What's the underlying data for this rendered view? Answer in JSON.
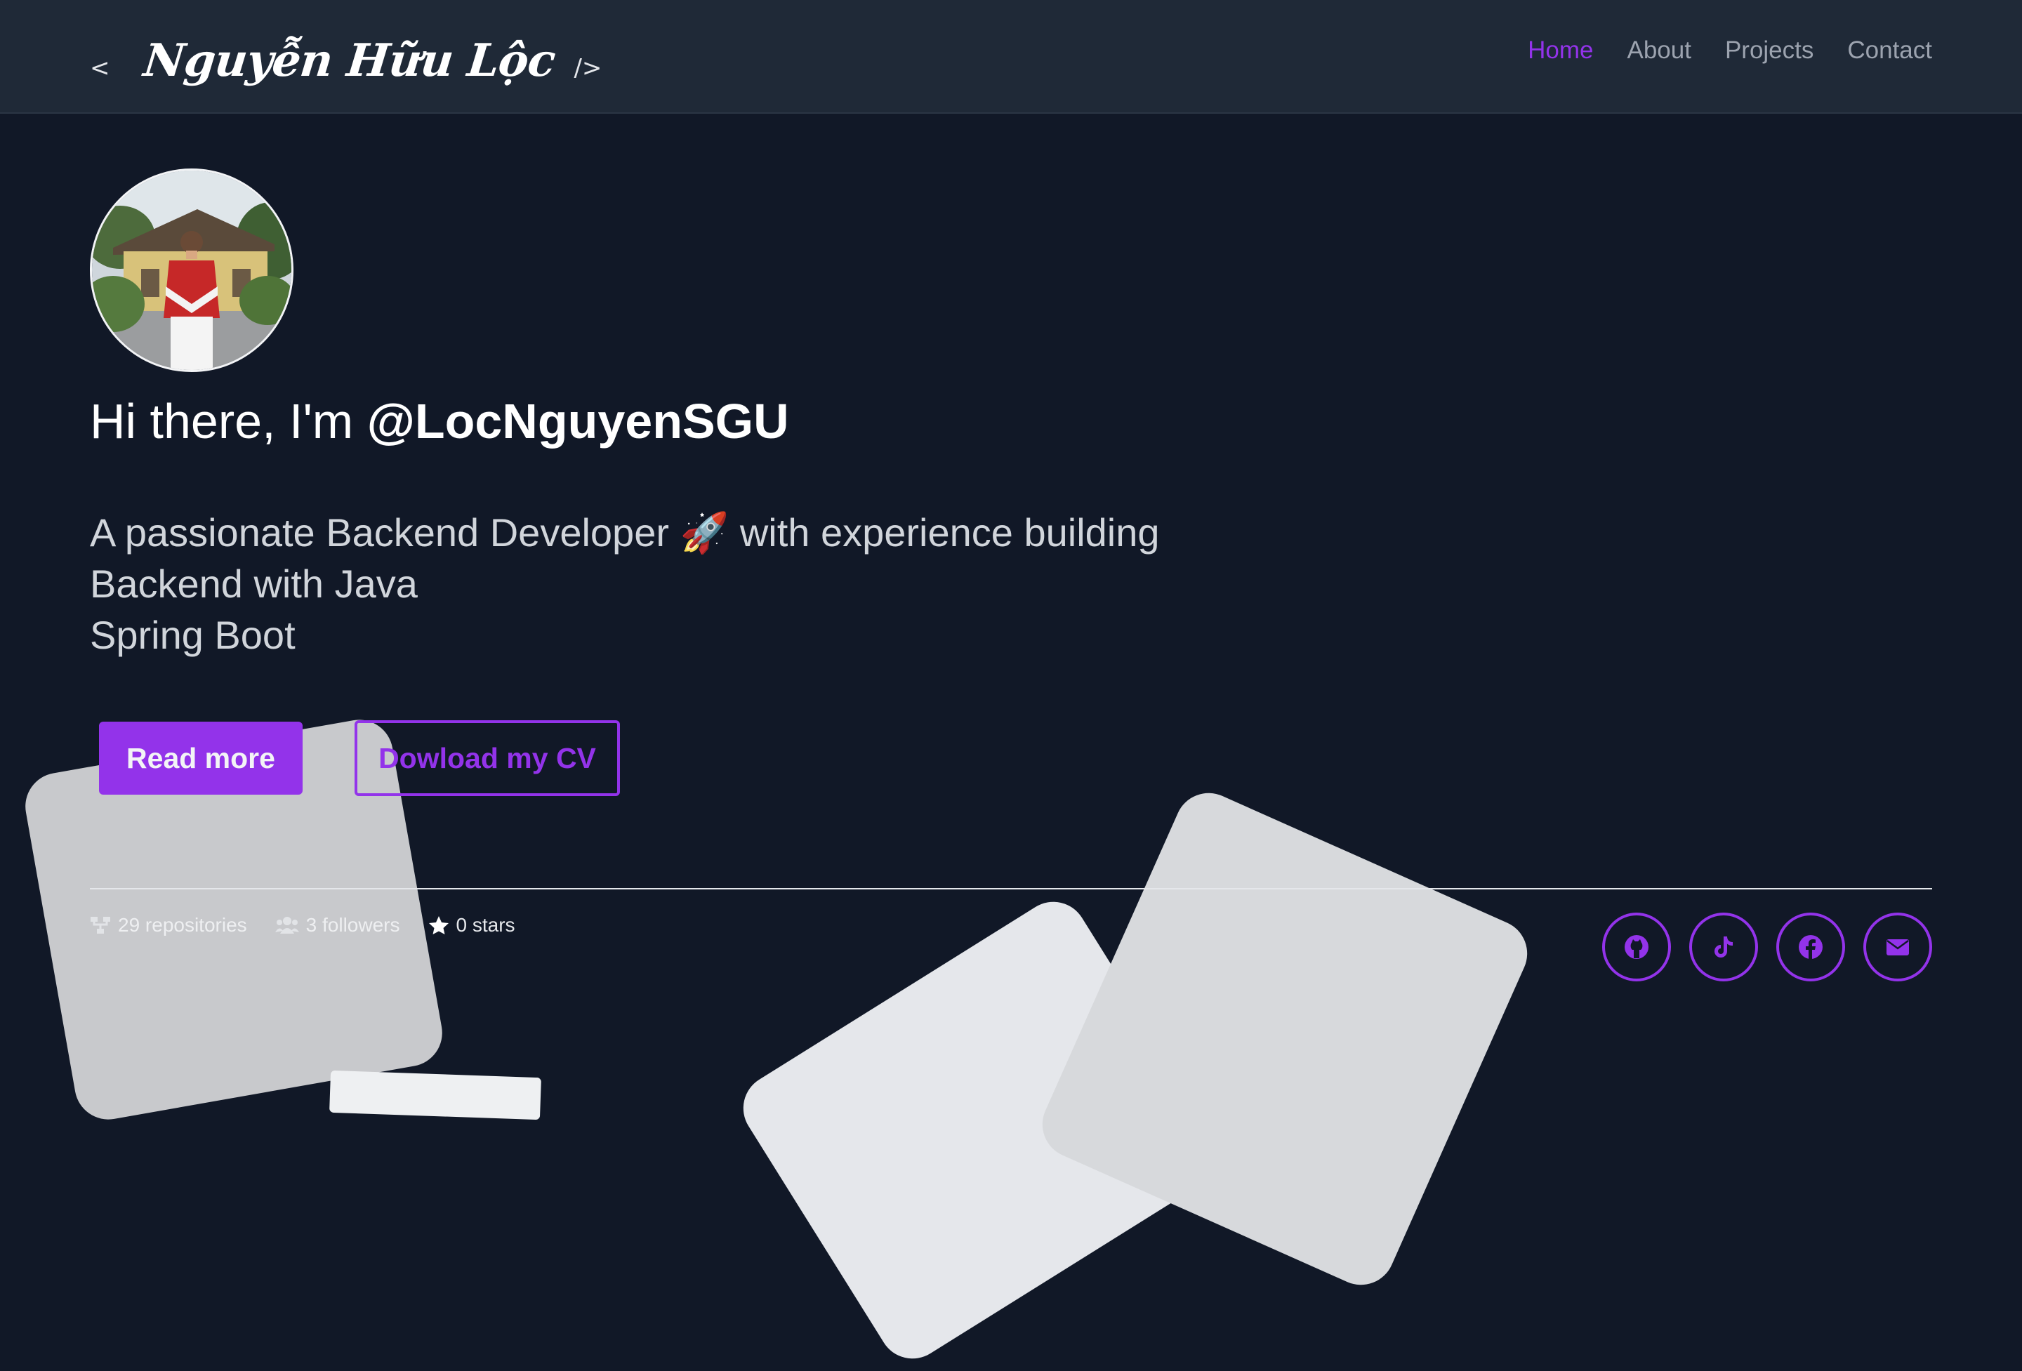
{
  "header": {
    "logo": {
      "open_bracket": "<",
      "name": "Nguyễn Hữu Lộc",
      "close_bracket": "/>"
    },
    "nav": [
      {
        "label": "Home",
        "active": true
      },
      {
        "label": "About",
        "active": false
      },
      {
        "label": "Projects",
        "active": false
      },
      {
        "label": "Contact",
        "active": false
      }
    ]
  },
  "hero": {
    "greeting": "Hi there, I'm",
    "handle": "@LocNguyenSGU",
    "tagline_lines": [
      "A passionate Backend Developer 🚀 with experience building",
      "Backend with Java",
      "Spring Boot"
    ],
    "buttons": {
      "read_more": "Read more",
      "download_cv": "Dowload my CV"
    }
  },
  "stats": {
    "repositories": "29 repositories",
    "followers": "3 followers",
    "stars": "0 stars"
  },
  "socials": [
    {
      "icon": "github-icon"
    },
    {
      "icon": "tiktok-icon"
    },
    {
      "icon": "facebook-icon"
    },
    {
      "icon": "email-icon"
    }
  ],
  "colors": {
    "accent": "#9333ea",
    "background": "#111827",
    "header_background": "#1f2937"
  }
}
